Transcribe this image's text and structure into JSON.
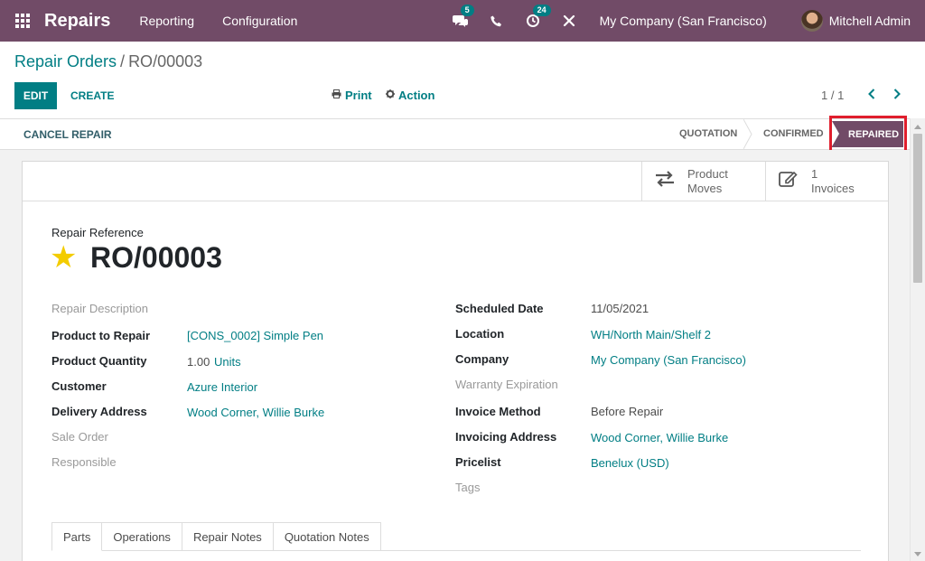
{
  "navbar": {
    "app_name": "Repairs",
    "menus": [
      "Reporting",
      "Configuration"
    ],
    "messages_badge": "5",
    "activities_badge": "24",
    "company": "My Company (San Francisco)",
    "user": "Mitchell Admin"
  },
  "breadcrumb": {
    "parent": "Repair Orders",
    "separator": "/",
    "current": "RO/00003"
  },
  "actions": {
    "edit": "EDIT",
    "create": "CREATE",
    "print": "Print",
    "action": "Action",
    "pager": "1 / 1"
  },
  "statusbar": {
    "cancel": "CANCEL REPAIR",
    "stages": [
      "QUOTATION",
      "CONFIRMED",
      "REPAIRED"
    ],
    "active_stage": "REPAIRED"
  },
  "smart_buttons": {
    "moves_line1": "Product",
    "moves_line2": "Moves",
    "invoices_count": "1",
    "invoices_label": "Invoices"
  },
  "form": {
    "ref_label": "Repair Reference",
    "ref": "RO/00003",
    "left": [
      {
        "label": "Repair Description",
        "value": ""
      },
      {
        "label": "Product to Repair",
        "value": "[CONS_0002] Simple Pen"
      },
      {
        "label": "Product Quantity",
        "value": "1.00",
        "unit": "Units"
      },
      {
        "label": "Customer",
        "value": "Azure Interior"
      },
      {
        "label": "Delivery Address",
        "value": "Wood Corner, Willie Burke"
      },
      {
        "label": "Sale Order",
        "value": ""
      },
      {
        "label": "Responsible",
        "value": ""
      }
    ],
    "right": [
      {
        "label": "Scheduled Date",
        "value": "11/05/2021"
      },
      {
        "label": "Location",
        "value": "WH/North Main/Shelf 2"
      },
      {
        "label": "Company",
        "value": "My Company (San Francisco)"
      },
      {
        "label": "Warranty Expiration",
        "value": ""
      },
      {
        "label": "Invoice Method",
        "value": "Before Repair"
      },
      {
        "label": "Invoicing Address",
        "value": "Wood Corner, Willie Burke"
      },
      {
        "label": "Pricelist",
        "value": "Benelux (USD)"
      },
      {
        "label": "Tags",
        "value": ""
      }
    ]
  },
  "tabs": [
    "Parts",
    "Operations",
    "Repair Notes",
    "Quotation Notes"
  ],
  "colors": {
    "navbar": "#714b67",
    "accent": "#017e84",
    "highlight": "#e01e2d",
    "star": "#f3cc00"
  }
}
